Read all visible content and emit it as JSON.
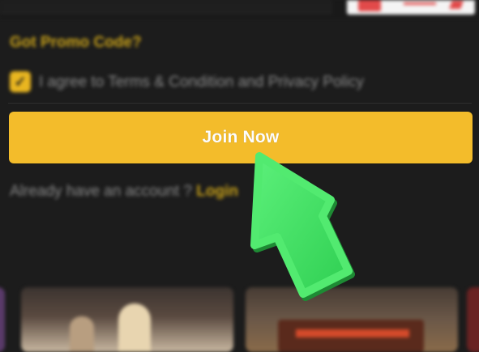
{
  "form": {
    "promo_link": "Got Promo Code?",
    "agree_text": "I agree to Terms & Condition and Privacy Policy",
    "join_button": "Join Now",
    "already_text": "Already have an account ?",
    "login_link": "Login"
  },
  "icons": {
    "agree_checkbox": "checkbox-checked-icon",
    "pointer": "green-arrow-pointer-icon"
  },
  "colors": {
    "background": "#1c1c1c",
    "accent": "#f3bc2b",
    "link": "#c9a21a",
    "pointer": "#44e064"
  }
}
